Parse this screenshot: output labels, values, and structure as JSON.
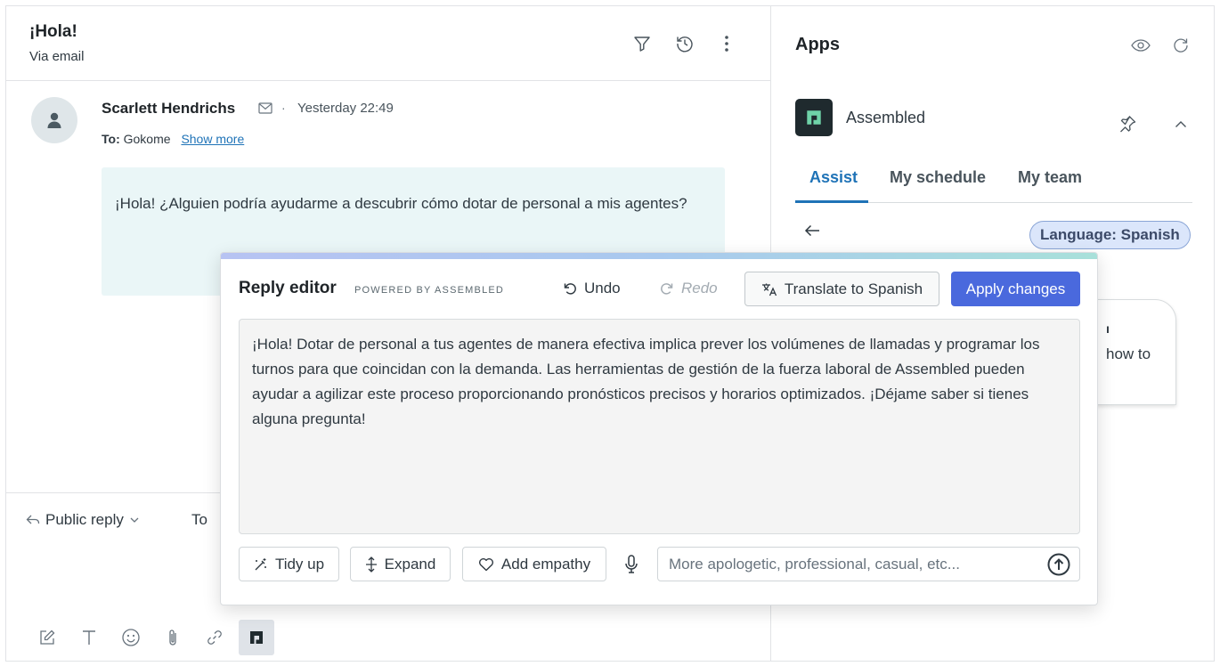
{
  "ticket": {
    "title": "¡Hola!",
    "channel": "Via email",
    "header_icons": [
      "filter-icon",
      "history-icon",
      "more-vertical-icon"
    ]
  },
  "message": {
    "author": "Scarlett Hendrichs",
    "separator": "·",
    "timestamp": "Yesterday 22:49",
    "to_label": "To:",
    "to_value": "Gokome",
    "show_more": "Show more",
    "body": "¡Hola! ¿Alguien podría ayudarme a descubrir cómo dotar de personal a mis agentes?"
  },
  "reply": {
    "mode": "Public reply",
    "to_label": "To",
    "toolbar_icons": [
      "compose-icon",
      "text-format-icon",
      "emoji-icon",
      "attachment-icon",
      "link-icon",
      "assembled-logo-icon"
    ]
  },
  "apps": {
    "title": "Apps",
    "app_name": "Assembled",
    "tabs": [
      {
        "label": "Assist",
        "active": true
      },
      {
        "label": "My schedule",
        "active": false
      },
      {
        "label": "My team",
        "active": false
      }
    ],
    "language_badge": "Language: Spanish",
    "card_peek_text": "how to"
  },
  "editor": {
    "title": "Reply editor",
    "powered_by": "POWERED BY ASSEMBLED",
    "undo_label": "Undo",
    "redo_label": "Redo",
    "translate_label": "Translate to Spanish",
    "apply_label": "Apply changes",
    "draft": "¡Hola! Dotar de personal a tus agentes de manera efectiva implica prever los volúmenes de llamadas y programar los turnos para que coincidan con la demanda. Las herramientas de gestión de la fuerza laboral de Assembled pueden ayudar a agilizar este proceso proporcionando pronósticos precisos y horarios optimizados. ¡Déjame saber si tienes alguna pregunta!",
    "chips": {
      "tidy_up": "Tidy up",
      "expand": "Expand",
      "add_empathy": "Add empathy"
    },
    "prompt_placeholder": "More apologetic, professional, casual, etc...",
    "accent_color": "#4a69dd"
  }
}
